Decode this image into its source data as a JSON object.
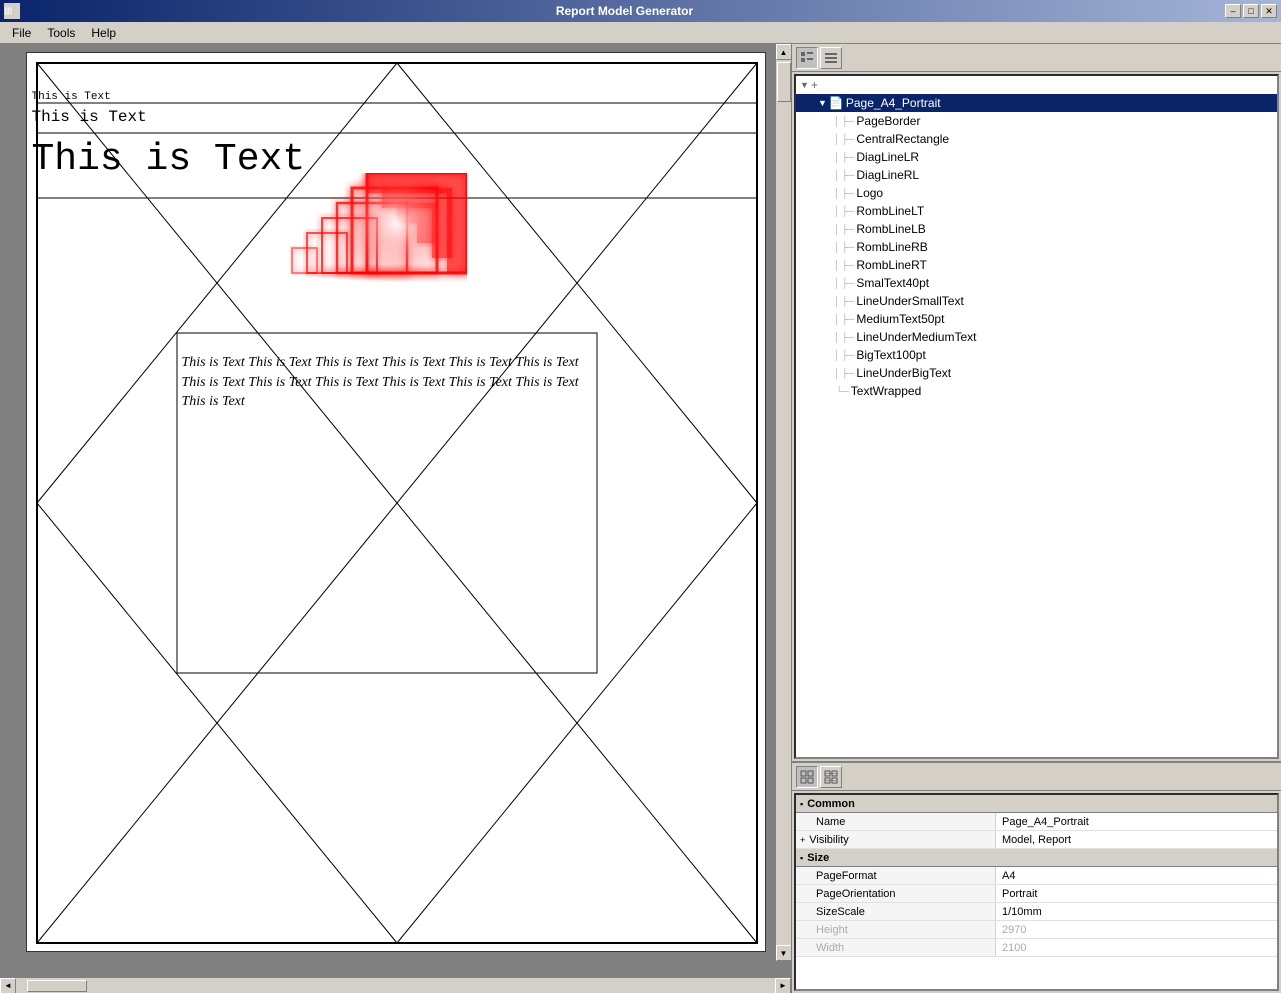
{
  "app": {
    "title": "Report Model Generator",
    "icon": "⊞"
  },
  "titlebar": {
    "minimize": "–",
    "maximize": "□",
    "close": "✕"
  },
  "menu": {
    "items": [
      "File",
      "Tools",
      "Help"
    ]
  },
  "toolbar": {
    "btn1_icon": "🗂",
    "btn2_icon": "💾"
  },
  "tree": {
    "root": {
      "label": "Page_A4_Portrait",
      "selected": true
    },
    "items": [
      {
        "label": "PageBorder",
        "indent": 2
      },
      {
        "label": "CentralRectangle",
        "indent": 2
      },
      {
        "label": "DiagLineLR",
        "indent": 2
      },
      {
        "label": "DiagLineRL",
        "indent": 2
      },
      {
        "label": "Logo",
        "indent": 2
      },
      {
        "label": "RombLineLT",
        "indent": 2
      },
      {
        "label": "RombLineLB",
        "indent": 2
      },
      {
        "label": "RombLineRB",
        "indent": 2
      },
      {
        "label": "RombLineRT",
        "indent": 2
      },
      {
        "label": "SmalText40pt",
        "indent": 2
      },
      {
        "label": "LineUnderSmallText",
        "indent": 2
      },
      {
        "label": "MediumText50pt",
        "indent": 2
      },
      {
        "label": "LineUnderMediumText",
        "indent": 2
      },
      {
        "label": "BigText100pt",
        "indent": 2
      },
      {
        "label": "LineUnderBigText",
        "indent": 2
      },
      {
        "label": "TextWrapped",
        "indent": 2
      }
    ]
  },
  "properties": {
    "sections": [
      {
        "label": "Common",
        "rows": [
          {
            "name": "Name",
            "value": "Page_A4_Portrait",
            "has_expand": false
          },
          {
            "name": "Visibility",
            "value": "Model, Report",
            "has_expand": true
          }
        ]
      },
      {
        "label": "Size",
        "rows": [
          {
            "name": "PageFormat",
            "value": "A4",
            "has_expand": false
          },
          {
            "name": "PageOrientation",
            "value": "Portrait",
            "has_expand": false
          },
          {
            "name": "SizeScale",
            "value": "1/10mm",
            "has_expand": false
          },
          {
            "name": "Height",
            "value": "2970",
            "has_expand": false
          },
          {
            "name": "Width",
            "value": "2100",
            "has_expand": false
          }
        ]
      }
    ]
  },
  "canvas": {
    "text_small": "This is Text",
    "text_medium": "This is Text",
    "text_large": "This is Text",
    "text_wrapped": "This is Text This is Text This is Text This is Text This is Text This is Text This is Text This is Text This is Text This is Text This is Text This is Text This is Text"
  }
}
